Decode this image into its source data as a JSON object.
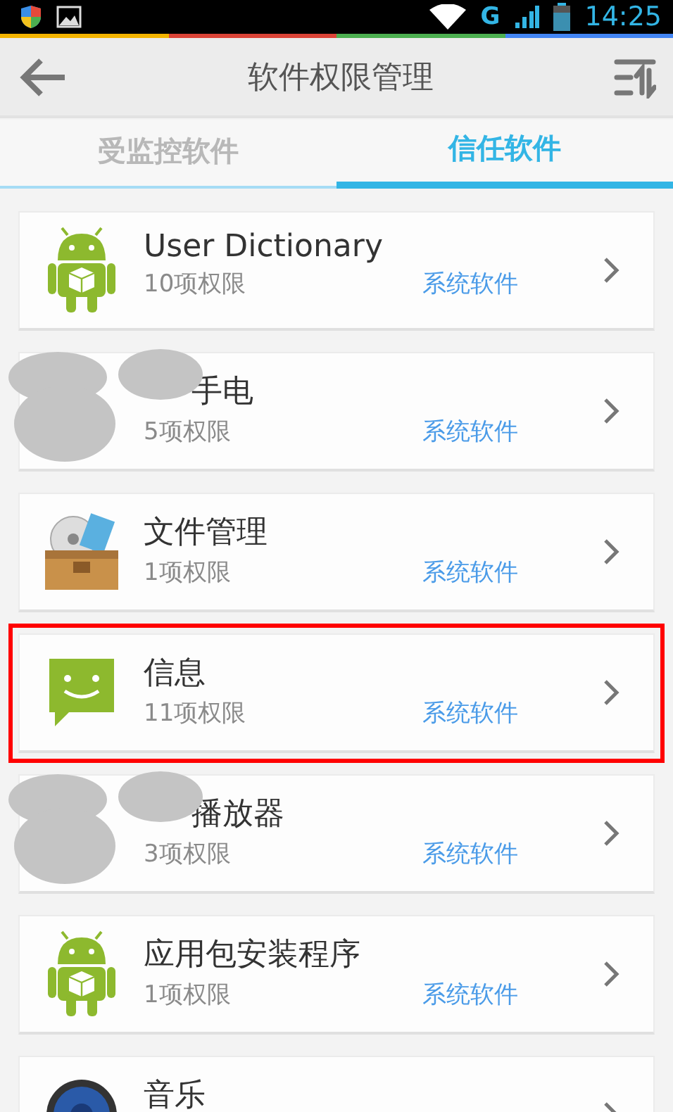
{
  "status_bar": {
    "time": "14:25",
    "network": "G"
  },
  "header": {
    "title": "软件权限管理"
  },
  "tabs": [
    {
      "label": "受监控软件",
      "selected": false
    },
    {
      "label": "信任软件",
      "selected": true
    }
  ],
  "apps": [
    {
      "kind": "android",
      "title": "User Dictionary",
      "permissions": "10项权限",
      "type": "系统软件",
      "redacted": false,
      "highlighted": false
    },
    {
      "title": "手电",
      "permissions": "5项权限",
      "type": "系统软件",
      "redacted": true,
      "highlighted": false
    },
    {
      "kind": "box",
      "title": "文件管理",
      "permissions": "1项权限",
      "type": "系统软件",
      "redacted": false,
      "highlighted": false
    },
    {
      "kind": "message",
      "title": "信息",
      "permissions": "11项权限",
      "type": "系统软件",
      "redacted": false,
      "highlighted": true
    },
    {
      "title": "播放器",
      "permissions": "3项权限",
      "type": "系统软件",
      "redacted": true,
      "highlighted": false
    },
    {
      "kind": "android",
      "title": "应用包安装程序",
      "permissions": "1项权限",
      "type": "系统软件",
      "redacted": false,
      "highlighted": false
    },
    {
      "kind": "speaker",
      "title": "音乐",
      "redacted": false,
      "highlighted": false
    }
  ]
}
